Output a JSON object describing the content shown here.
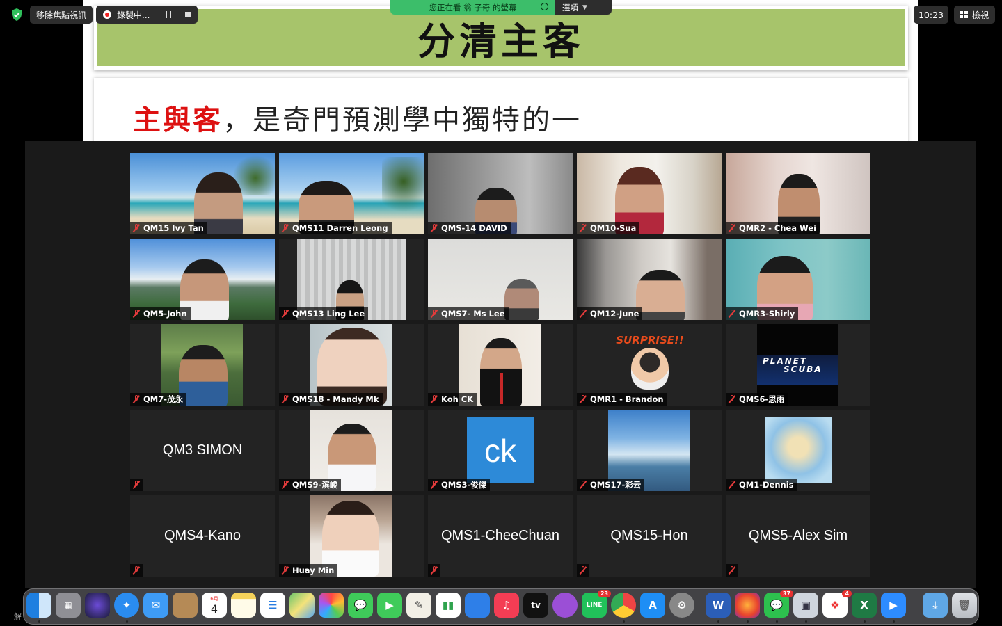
{
  "top_bar": {
    "exit_focus": "移除焦點視訊",
    "recording": "錄製中...",
    "share_banner": "您正在看 翁 子奇 的螢幕",
    "options": "選項",
    "clock": "10:23",
    "view": "檢視"
  },
  "slide": {
    "title": "分清主客",
    "line_highlight": "主與客",
    "line_rest": "，是奇門預測學中獨特的一"
  },
  "participants": [
    {
      "name": "QM15 Ivy Tan"
    },
    {
      "name": "QMS11 Darren Leong"
    },
    {
      "name": "QMS-14 DAVID"
    },
    {
      "name": "QM10-Sua"
    },
    {
      "name": "QMR2 - Chea Wei"
    },
    {
      "name": "QM5-John"
    },
    {
      "name": "QMS13 Ling Lee"
    },
    {
      "name": "QMS7- Ms Lee"
    },
    {
      "name": "QM12-June"
    },
    {
      "name": "QMR3-Shirly"
    },
    {
      "name": "QM7-茂永"
    },
    {
      "name": "QMS18 - Mandy Mk"
    },
    {
      "name": "Koh CK"
    },
    {
      "name": "QMR1 - Brandon",
      "avatar_text": "SURPRISE!!"
    },
    {
      "name": "QMS6-思雨",
      "avatar_text_1": "PLANET",
      "avatar_text_2": "SCUBA"
    },
    {
      "name": "QM3 SIMON"
    },
    {
      "name": "QMS9-滨峻"
    },
    {
      "name": "QMS3-俊傑",
      "avatar_text": "ck"
    },
    {
      "name": "QMS17-彩云"
    },
    {
      "name": "QM1-Dennis"
    },
    {
      "name": "QMS4-Kano"
    },
    {
      "name": "Huay Min"
    },
    {
      "name": "QMS1-CheeChuan"
    },
    {
      "name": "QMS15-Hon"
    },
    {
      "name": "QMS5-Alex Sim"
    }
  ],
  "dock": {
    "peek_text": "解",
    "calendar_month": "6月",
    "calendar_day": "4",
    "line_badge": "23",
    "wechat_badge": "37",
    "photos_badge": "4",
    "appletv_label": "tv",
    "line_label": "LINE"
  }
}
